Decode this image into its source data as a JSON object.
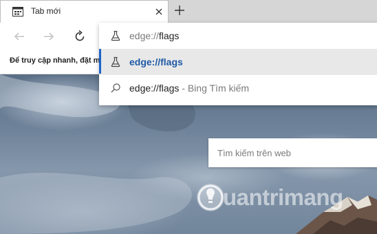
{
  "tab": {
    "title": "Tab mới",
    "icon": "newtab-page-icon"
  },
  "toolbar": {
    "back_icon": "back-arrow-icon",
    "forward_icon": "forward-arrow-icon",
    "refresh_icon": "refresh-icon"
  },
  "favorites_bar": {
    "text": "Để truy cập nhanh, đặt m"
  },
  "address_dropdown": {
    "input": {
      "typed_prefix": "edge://",
      "completion": "flags"
    },
    "suggestions": [
      {
        "text": "edge://flags",
        "icon": "flask-icon",
        "selected": true
      },
      {
        "text": "edge://flags",
        "suffix_separator": " - ",
        "suffix": "Bing Tìm kiếm",
        "icon": "search-icon",
        "selected": false
      }
    ]
  },
  "search_box": {
    "placeholder": "Tìm kiếm trên web"
  },
  "watermark": {
    "text": "uantrimang"
  },
  "colors": {
    "accent": "#1e63c9",
    "selected_text": "#1f5aa6",
    "selected_bg": "#e8e8e8"
  }
}
